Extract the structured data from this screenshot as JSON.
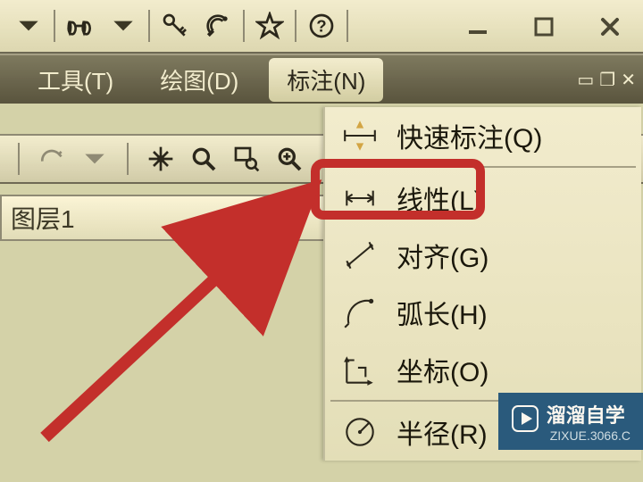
{
  "menu": {
    "tools": "工具(T)",
    "draw": "绘图(D)",
    "annotate": "标注(N)"
  },
  "layer": {
    "label": "图层1"
  },
  "dropdown": {
    "quick_dim": "快速标注(Q)",
    "linear": "线性(L)",
    "aligned": "对齐(G)",
    "arc_length": "弧长(H)",
    "ordinate": "坐标(O)",
    "radius": "半径(R)"
  },
  "watermark": {
    "brand": "溜溜自学",
    "url": "ZIXUE.3066.C"
  }
}
